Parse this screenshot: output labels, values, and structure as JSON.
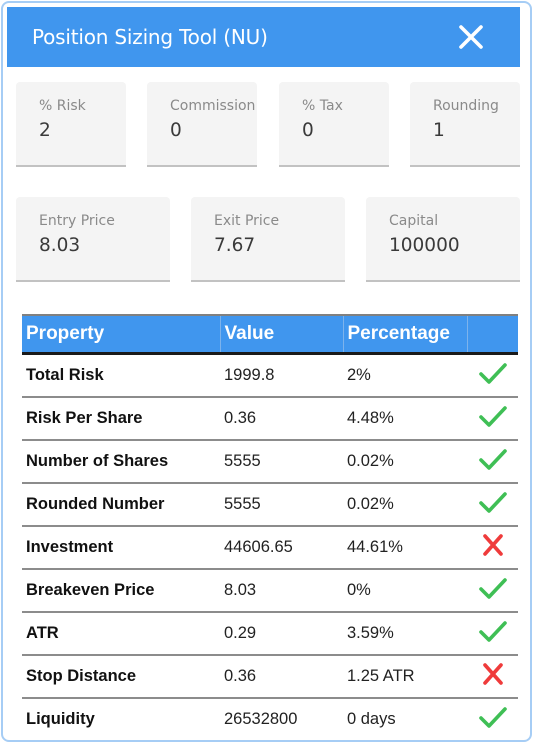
{
  "dialog": {
    "title": "Position Sizing Tool (NU)",
    "close_icon": "close-icon",
    "colors": {
      "header": "#4096ee",
      "ok": "#3fbf55",
      "fail": "#ef3b3b",
      "border": "#a6cdf5"
    }
  },
  "inputs_row1": [
    {
      "label": "% Risk",
      "value": "2"
    },
    {
      "label": "Commission",
      "value": "0"
    },
    {
      "label": "% Tax",
      "value": "0"
    },
    {
      "label": "Rounding",
      "value": "1"
    }
  ],
  "inputs_row2": [
    {
      "label": "Entry Price",
      "value": "8.03"
    },
    {
      "label": "Exit Price",
      "value": "7.67"
    },
    {
      "label": "Capital",
      "value": "100000"
    }
  ],
  "table": {
    "headers": [
      "Property",
      "Value",
      "Percentage",
      ""
    ],
    "rows": [
      {
        "property": "Total Risk",
        "value": "1999.8",
        "percentage": "2%",
        "status": "ok"
      },
      {
        "property": "Risk Per Share",
        "value": "0.36",
        "percentage": "4.48%",
        "status": "ok"
      },
      {
        "property": "Number of Shares",
        "value": "5555",
        "percentage": "0.02%",
        "status": "ok"
      },
      {
        "property": "Rounded Number",
        "value": "5555",
        "percentage": "0.02%",
        "status": "ok"
      },
      {
        "property": "Investment",
        "value": "44606.65",
        "percentage": "44.61%",
        "status": "fail"
      },
      {
        "property": "Breakeven Price",
        "value": "8.03",
        "percentage": "0%",
        "status": "ok"
      },
      {
        "property": "ATR",
        "value": "0.29",
        "percentage": "3.59%",
        "status": "ok"
      },
      {
        "property": "Stop Distance",
        "value": "0.36",
        "percentage": "1.25 ATR",
        "status": "fail"
      },
      {
        "property": "Liquidity",
        "value": "26532800",
        "percentage": "0 days",
        "status": "ok"
      }
    ]
  }
}
